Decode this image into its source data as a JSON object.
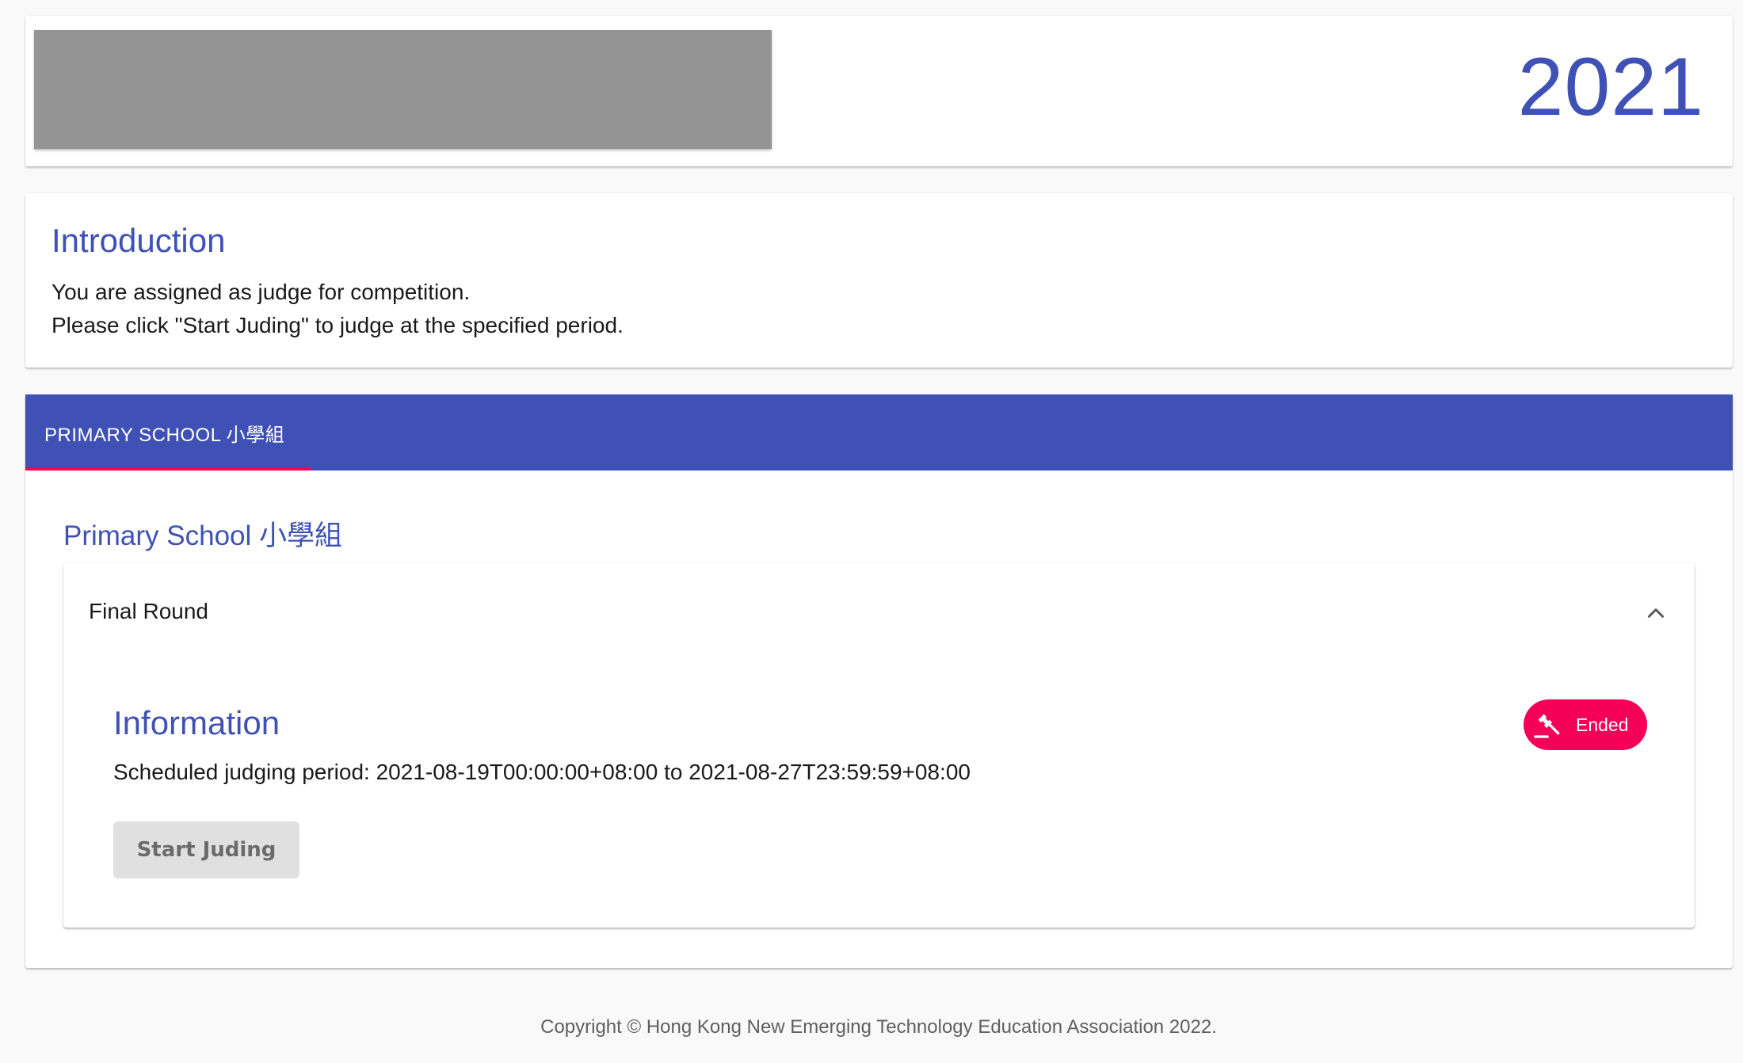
{
  "header": {
    "year": "2021"
  },
  "intro": {
    "title": "Introduction",
    "line1": "You are assigned as judge for competition.",
    "line2": "Please click \"Start Juding\" to judge at the specified period."
  },
  "tabs": [
    {
      "label": "PRIMARY SCHOOL 小學組",
      "selected": true
    }
  ],
  "section": {
    "title": "Primary School 小學組",
    "round": {
      "title": "Final Round",
      "expanded": true,
      "info_title": "Information",
      "period_text": "Scheduled judging period: 2021-08-19T00:00:00+08:00 to 2021-08-27T23:59:59+08:00",
      "start_button": "Start Juding",
      "status": {
        "label": "Ended",
        "icon": "gavel-icon",
        "color": "#f50057"
      }
    }
  },
  "footer": {
    "copyright": "Copyright © Hong Kong New Emerging Technology Education Association 2022."
  },
  "colors": {
    "primary": "#3f51b5",
    "accent": "#f50057",
    "background": "#f9f9f9"
  }
}
